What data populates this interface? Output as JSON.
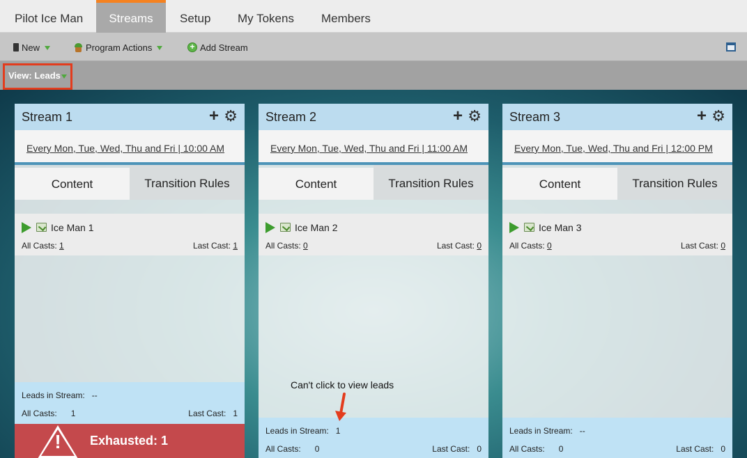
{
  "tabs": [
    {
      "label": "Pilot Ice Man",
      "active": false
    },
    {
      "label": "Streams",
      "active": true
    },
    {
      "label": "Setup",
      "active": false
    },
    {
      "label": "My Tokens",
      "active": false
    },
    {
      "label": "Members",
      "active": false
    }
  ],
  "toolbar": {
    "new_label": "New",
    "program_actions_label": "Program Actions",
    "add_stream_label": "Add Stream"
  },
  "view": {
    "label": "View: Leads"
  },
  "streams": [
    {
      "title": "Stream 1",
      "schedule": "Every Mon, Tue, Wed, Thu and Fri | 10:00 AM",
      "tab_content": "Content",
      "tab_rules": "Transition Rules",
      "item_name": "Ice Man 1",
      "all_casts_label": "All Casts:",
      "all_casts_value": "1",
      "last_cast_label": "Last Cast:",
      "last_cast_value": "1",
      "leads_label": "Leads in Stream:",
      "leads_value": "--",
      "foot_all_casts_label": "All Casts:",
      "foot_all_casts_value": "1",
      "foot_last_cast_label": "Last Cast:",
      "foot_last_cast_value": "1",
      "exhausted_label": "Exhausted:",
      "exhausted_value": "1"
    },
    {
      "title": "Stream 2",
      "schedule": "Every Mon, Tue, Wed, Thu and Fri | 11:00 AM",
      "tab_content": "Content",
      "tab_rules": "Transition Rules",
      "item_name": "Ice Man 2",
      "all_casts_label": "All Casts:",
      "all_casts_value": "0",
      "last_cast_label": "Last Cast:",
      "last_cast_value": "0",
      "leads_label": "Leads in Stream:",
      "leads_value": "1",
      "foot_all_casts_label": "All Casts:",
      "foot_all_casts_value": "0",
      "foot_last_cast_label": "Last Cast:",
      "foot_last_cast_value": "0"
    },
    {
      "title": "Stream 3",
      "schedule": "Every Mon, Tue, Wed, Thu and Fri | 12:00 PM",
      "tab_content": "Content",
      "tab_rules": "Transition Rules",
      "item_name": "Ice Man 3",
      "all_casts_label": "All Casts:",
      "all_casts_value": "0",
      "last_cast_label": "Last Cast:",
      "last_cast_value": "0",
      "leads_label": "Leads in Stream:",
      "leads_value": "--",
      "foot_all_casts_label": "All Casts:",
      "foot_all_casts_value": "0",
      "foot_last_cast_label": "Last Cast:",
      "foot_last_cast_value": "0"
    }
  ],
  "annotation": {
    "text": "Can't click to view leads"
  },
  "colors": {
    "accent_tab": "#f58220",
    "highlight_box": "#e33c1d",
    "exhausted_bg": "#c4494c",
    "stream_header": "#bcdcef",
    "stream_footer": "#bfe2f5"
  }
}
